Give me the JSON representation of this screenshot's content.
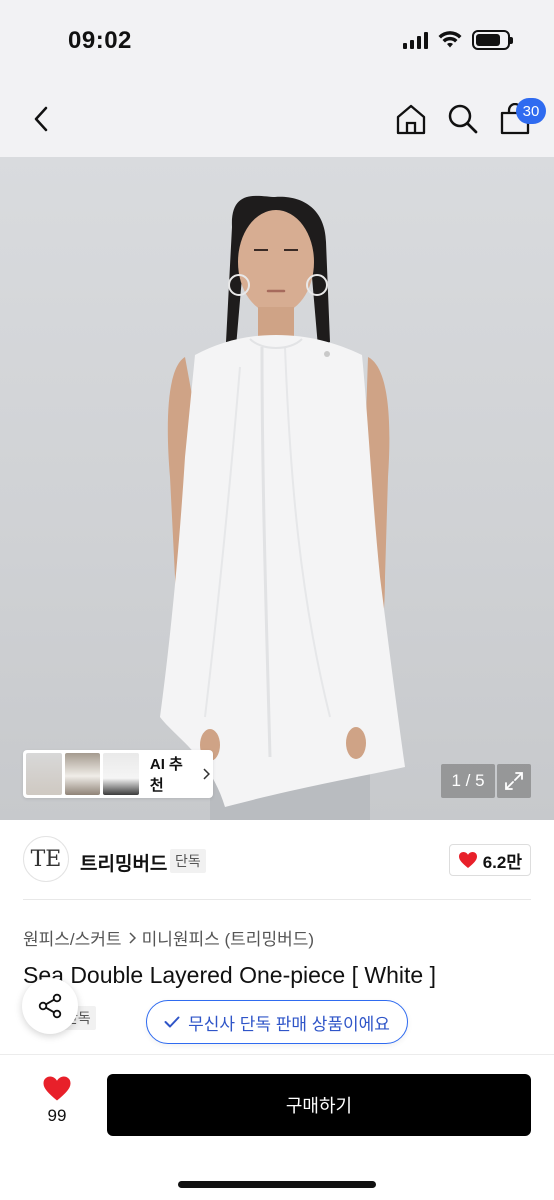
{
  "status_bar": {
    "time": "09:02"
  },
  "nav": {
    "cart_count": "30"
  },
  "gallery": {
    "ai_label": "AI 추천",
    "page_indicator": "1 / 5"
  },
  "brand": {
    "logo_text": "TE",
    "name": "트리밍버드",
    "tag": "단독",
    "likes": "6.2만"
  },
  "product": {
    "breadcrumb": [
      "원피스/스커트",
      "미니원피스 (트리밍버드)"
    ],
    "title": "Sea Double Layered One-piece [ White ]",
    "exclusive_tag": "단독",
    "exclusive_banner": "무신사 단독 판매 상품이에요"
  },
  "bottom_bar": {
    "wish_count": "99",
    "buy_label": "구매하기"
  },
  "colors": {
    "accent_blue": "#2f6bf0",
    "like_red": "#e8202a",
    "buy_button": "#000000"
  }
}
